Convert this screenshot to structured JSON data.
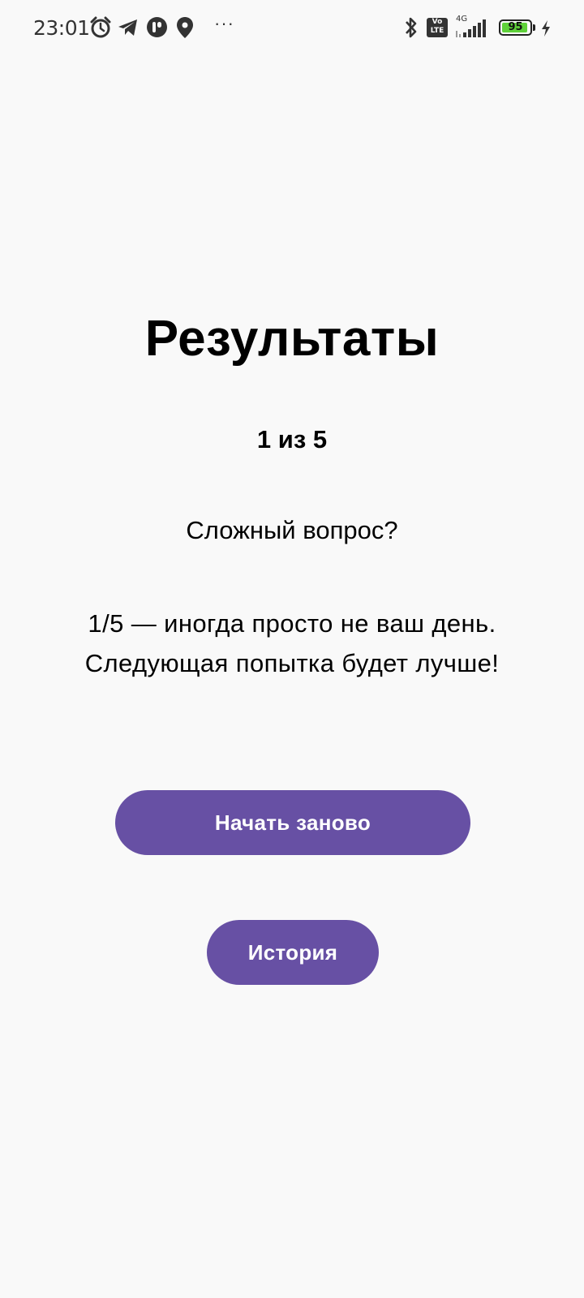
{
  "status_bar": {
    "time": "23:01",
    "more_indicator": "···",
    "battery_level": "95",
    "battery_fraction": 0.95,
    "battery_color": "#5fd13a",
    "left_icons": [
      "alarm-icon",
      "telegram-icon",
      "app-notification-icon",
      "location-icon"
    ],
    "right_icons": [
      "bluetooth-icon",
      "volte-icon",
      "signal-4g-icon",
      "battery-icon",
      "charging-icon"
    ],
    "network_label": "4G",
    "volte_label_top": "Vo",
    "volte_label_bottom": "LTE"
  },
  "results": {
    "title": "Результаты",
    "score": "1 из 5",
    "subtitle": "Сложный вопрос?",
    "message_line1": "1/5 — иногда просто не ваш день.",
    "message_line2": "Следующая попытка будет лучше!"
  },
  "actions": {
    "restart_label": "Начать заново",
    "history_label": "История",
    "accent_color": "#6750a4"
  }
}
